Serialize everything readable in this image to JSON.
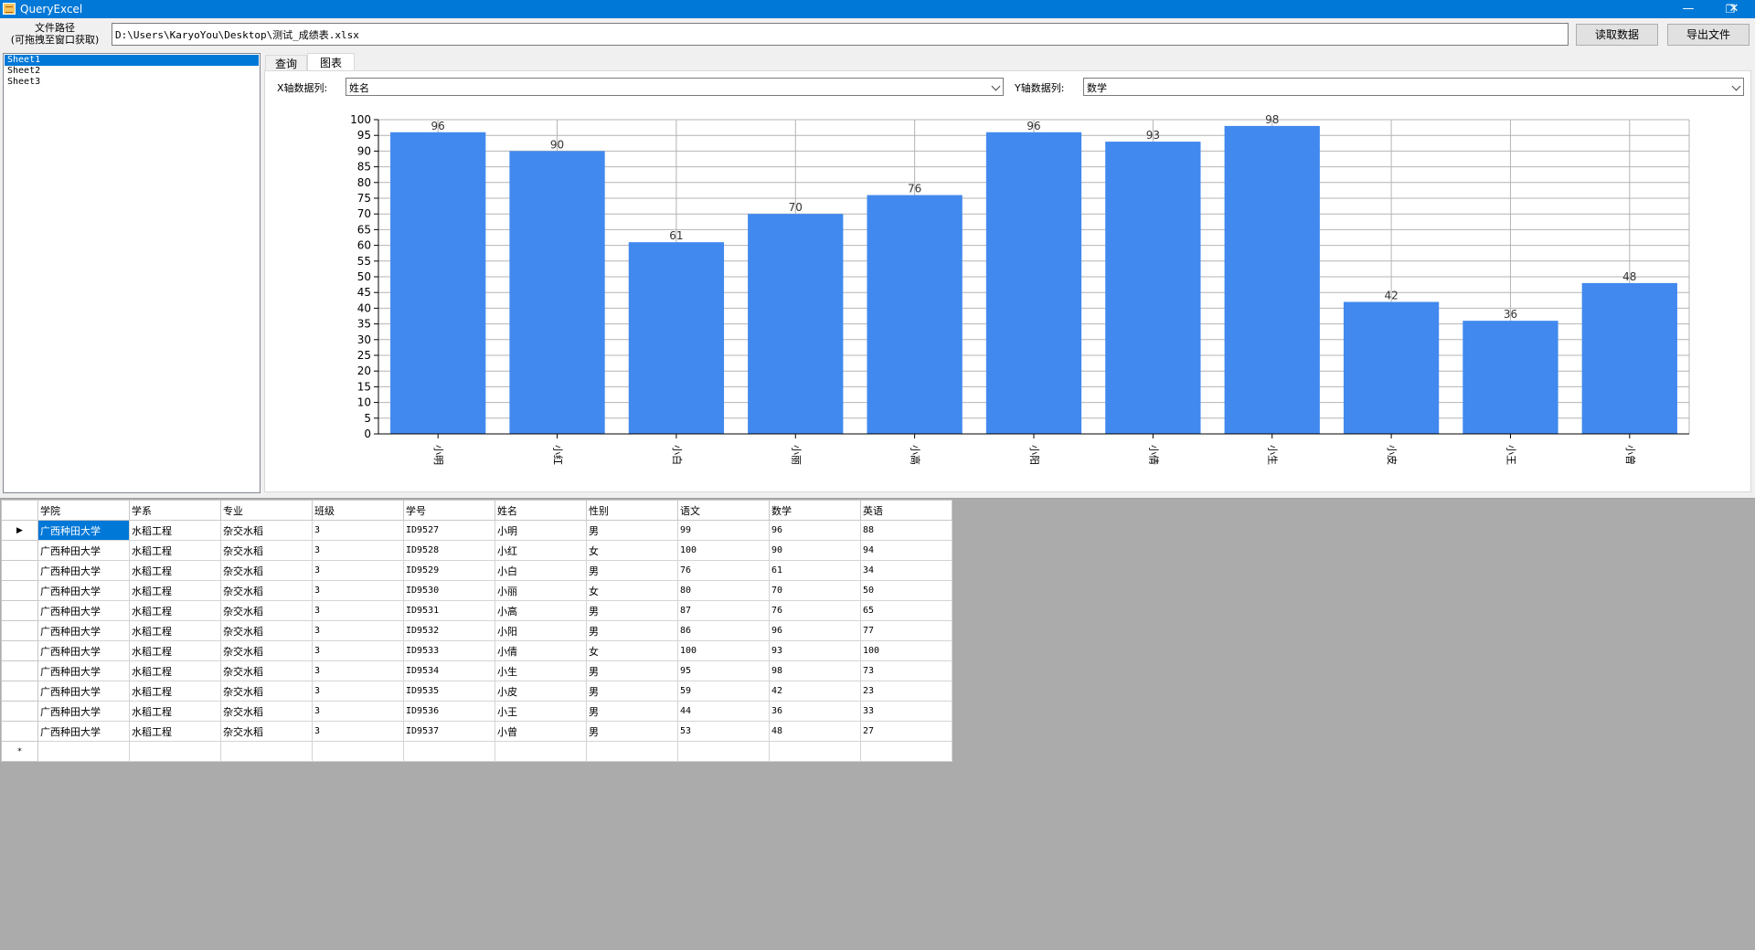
{
  "window": {
    "title": "QueryExcel",
    "minimize": "—",
    "restore": "❐",
    "close": "✕"
  },
  "toolbar": {
    "path_label_1": "文件路径",
    "path_label_2": "(可拖拽至窗口获取)",
    "path_value": "D:\\Users\\KaryoYou\\Desktop\\测试_成绩表.xlsx",
    "read_label": "读取数据",
    "export_label": "导出文件"
  },
  "sheets": [
    "Sheet1",
    "Sheet2",
    "Sheet3"
  ],
  "selected_sheet": 0,
  "tabs": [
    "查询",
    "图表"
  ],
  "active_tab": 1,
  "chart_settings": {
    "x_label": "X轴数据列:",
    "x_value": "姓名",
    "y_label": "Y轴数据列:",
    "y_value": "数学"
  },
  "chart_data": {
    "type": "bar",
    "categories": [
      "小明",
      "小红",
      "小白",
      "小丽",
      "小高",
      "小阳",
      "小倩",
      "小生",
      "小皮",
      "小王",
      "小曾"
    ],
    "values": [
      96,
      90,
      61,
      70,
      76,
      96,
      93,
      98,
      42,
      36,
      48
    ],
    "ylim": [
      0,
      100
    ],
    "ytick_step": 5,
    "grid": true,
    "bar_color": "#4189ee"
  },
  "table": {
    "columns": [
      "学院",
      "学系",
      "专业",
      "班级",
      "学号",
      "姓名",
      "性别",
      "语文",
      "数学",
      "英语"
    ],
    "rows": [
      [
        "广西种田大学",
        "水稻工程",
        "杂交水稻",
        "3",
        "ID9527",
        "小明",
        "男",
        "99",
        "96",
        "88"
      ],
      [
        "广西种田大学",
        "水稻工程",
        "杂交水稻",
        "3",
        "ID9528",
        "小红",
        "女",
        "100",
        "90",
        "94"
      ],
      [
        "广西种田大学",
        "水稻工程",
        "杂交水稻",
        "3",
        "ID9529",
        "小白",
        "男",
        "76",
        "61",
        "34"
      ],
      [
        "广西种田大学",
        "水稻工程",
        "杂交水稻",
        "3",
        "ID9530",
        "小丽",
        "女",
        "80",
        "70",
        "50"
      ],
      [
        "广西种田大学",
        "水稻工程",
        "杂交水稻",
        "3",
        "ID9531",
        "小高",
        "男",
        "87",
        "76",
        "65"
      ],
      [
        "广西种田大学",
        "水稻工程",
        "杂交水稻",
        "3",
        "ID9532",
        "小阳",
        "男",
        "86",
        "96",
        "77"
      ],
      [
        "广西种田大学",
        "水稻工程",
        "杂交水稻",
        "3",
        "ID9533",
        "小倩",
        "女",
        "100",
        "93",
        "100"
      ],
      [
        "广西种田大学",
        "水稻工程",
        "杂交水稻",
        "3",
        "ID9534",
        "小生",
        "男",
        "95",
        "98",
        "73"
      ],
      [
        "广西种田大学",
        "水稻工程",
        "杂交水稻",
        "3",
        "ID9535",
        "小皮",
        "男",
        "59",
        "42",
        "23"
      ],
      [
        "广西种田大学",
        "水稻工程",
        "杂交水稻",
        "3",
        "ID9536",
        "小王",
        "男",
        "44",
        "36",
        "33"
      ],
      [
        "广西种田大学",
        "水稻工程",
        "杂交水稻",
        "3",
        "ID9537",
        "小曾",
        "男",
        "53",
        "48",
        "27"
      ]
    ],
    "current_row_marker": "▶",
    "new_row_marker": "*"
  }
}
